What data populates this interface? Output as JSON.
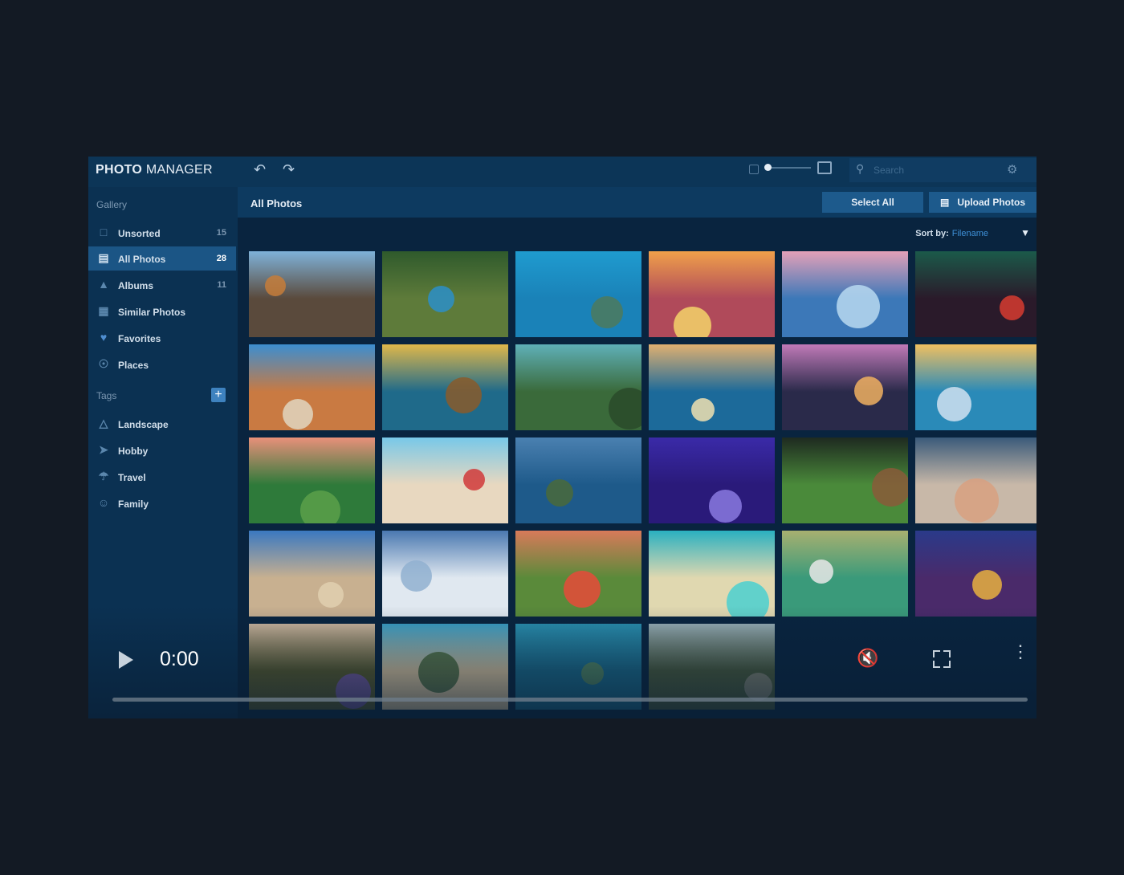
{
  "app": {
    "logo_bold": "PHOTO",
    "logo_light": " MANAGER",
    "search_placeholder": "Search"
  },
  "sidebar": {
    "gallery_label": "Gallery",
    "items": [
      {
        "label": "Unsorted",
        "count": "15",
        "icon": "unsorted-icon"
      },
      {
        "label": "All Photos",
        "count": "28",
        "icon": "photos-icon"
      },
      {
        "label": "Albums",
        "count": "11",
        "icon": "albums-icon"
      },
      {
        "label": "Similar Photos",
        "count": "",
        "icon": "similar-icon"
      },
      {
        "label": "Favorites",
        "count": "",
        "icon": "heart-icon"
      },
      {
        "label": "Places",
        "count": "",
        "icon": "pin-icon"
      }
    ],
    "tags_label": "Tags",
    "tags": [
      {
        "label": "Landscape",
        "icon": "landscape-icon"
      },
      {
        "label": "Hobby",
        "icon": "plane-icon"
      },
      {
        "label": "Travel",
        "icon": "travel-icon"
      },
      {
        "label": "Family",
        "icon": "family-icon"
      }
    ]
  },
  "content": {
    "title": "All Photos",
    "select_all": "Select All",
    "upload": "Upload Photos",
    "sort_label": "Sort by:",
    "sort_value": "Filename"
  },
  "photos": [
    {
      "sky": "#7fb2d9",
      "ground": "#5a4a3c",
      "subject": "#c67c3a"
    },
    {
      "sky": "#2f5a2c",
      "ground": "#5e7b3a",
      "subject": "#2b8fc9"
    },
    {
      "sky": "#1f9bcf",
      "ground": "#1a82b8",
      "subject": "#4d7a5c"
    },
    {
      "sky": "#f0a04a",
      "ground": "#b04a5a",
      "subject": "#f5d36a"
    },
    {
      "sky": "#e4a0b8",
      "ground": "#3c78b8",
      "subject": "#b9d9f0"
    },
    {
      "sky": "#1b5a4a",
      "ground": "#2a1a2a",
      "subject": "#d73c30"
    },
    {
      "sky": "#3c8ed0",
      "ground": "#c97a42",
      "subject": "#e0d6c0"
    },
    {
      "sky": "#e0b84a",
      "ground": "#1f6a8a",
      "subject": "#8a5a2a"
    },
    {
      "sky": "#5fb0b8",
      "ground": "#3a6a3a",
      "subject": "#2a4a2a"
    },
    {
      "sky": "#e0b070",
      "ground": "#1c6a9a",
      "subject": "#f0e0b0"
    },
    {
      "sky": "#c07ab8",
      "ground": "#2a2a4a",
      "subject": "#f0b060"
    },
    {
      "sky": "#f0c060",
      "ground": "#2a8ab8",
      "subject": "#d0e0f0"
    },
    {
      "sky": "#e8907a",
      "ground": "#2e7a3a",
      "subject": "#5aa04a"
    },
    {
      "sky": "#78c8e8",
      "ground": "#e8d8c0",
      "subject": "#d03a3a"
    },
    {
      "sky": "#4a80b0",
      "ground": "#1e5a8a",
      "subject": "#4a6a3a"
    },
    {
      "sky": "#3a2aa8",
      "ground": "#2a1a7a",
      "subject": "#8a7ae0"
    },
    {
      "sky": "#1e2a20",
      "ground": "#4a8a3a",
      "subject": "#8a5a3a"
    },
    {
      "sky": "#3a5a7a",
      "ground": "#c8b8a8",
      "subject": "#d8a080"
    },
    {
      "sky": "#3a78c0",
      "ground": "#c8b090",
      "subject": "#e0d0b0"
    },
    {
      "sky": "#4a78b0",
      "ground": "#e0e8f0",
      "subject": "#90b0d0"
    },
    {
      "sky": "#d87a5a",
      "ground": "#5a8a3a",
      "subject": "#e84a3a"
    },
    {
      "sky": "#2ab0c0",
      "ground": "#e0d8b0",
      "subject": "#4ad0d0"
    },
    {
      "sky": "#a8b070",
      "ground": "#3a9a7a",
      "subject": "#e8e8e8"
    },
    {
      "sky": "#2a3a8a",
      "ground": "#4a2a6a",
      "subject": "#e8b040"
    },
    {
      "sky": "#d0b8a0",
      "ground": "#5a5a2a",
      "subject": "#7a5ab0"
    },
    {
      "sky": "#3aa0c8",
      "ground": "#e0c8a0",
      "subject": "#4a6a3a"
    },
    {
      "sky": "#2a90b0",
      "ground": "#1a6a8a",
      "subject": "#5a8a5a"
    },
    {
      "sky": "#9ab0b8",
      "ground": "#4a5a3a",
      "subject": "#8a8a7a"
    }
  ],
  "player": {
    "time": "0:00"
  }
}
